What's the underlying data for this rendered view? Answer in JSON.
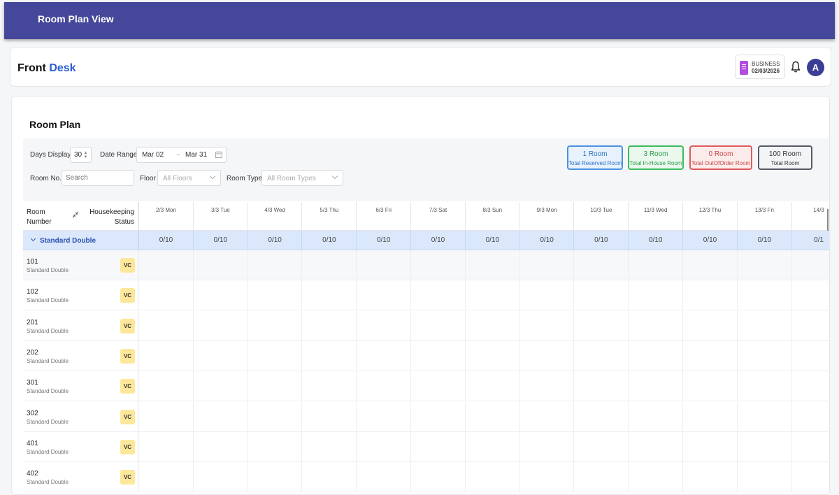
{
  "topbar": {
    "title": "Room Plan View"
  },
  "header": {
    "brand_part1": "Front",
    "brand_part2": "Desk",
    "business_label": "BUSINESS",
    "business_date": "02/03/2026",
    "avatar_initial": "A"
  },
  "room_plan": {
    "title": "Room Plan",
    "days_display_label": "Days Display",
    "days_display_value": "30",
    "date_range_label": "Date Range",
    "date_start": "Mar 02",
    "date_end": "Mar 31",
    "room_no_label": "Room No.",
    "room_no_placeholder": "Search",
    "floor_label": "Floor",
    "floor_value": "All Floors",
    "room_type_label": "Room Type",
    "room_type_value": "All Room Types"
  },
  "stats": [
    {
      "value": "1 Room",
      "caption": "Total Reserved Room",
      "color": "#4a90e2",
      "bg": "#e8f2fd",
      "text": "#2a6fc4"
    },
    {
      "value": "3 Room",
      "caption": "Total In-House Room",
      "color": "#3dbb5c",
      "bg": "#eaf8ee",
      "text": "#2b9b48"
    },
    {
      "value": "0 Room",
      "caption": "Total OutOfOrder Room",
      "color": "#e05a5a",
      "bg": "#fcebeb",
      "text": "#c94444"
    },
    {
      "value": "100 Room",
      "caption": "Total Room",
      "color": "#555a66",
      "bg": "#f3f4f6",
      "text": "#333"
    }
  ],
  "grid": {
    "col_room_line1": "Room",
    "col_room_line2": "Number",
    "col_hk_line1": "Housekeeping",
    "col_hk_line2": "Status",
    "days": [
      "2/3 Mon",
      "3/3 Tue",
      "4/3 Wed",
      "5/3 Thu",
      "6/3 Fri",
      "7/3 Sat",
      "8/3 Sun",
      "9/3 Mon",
      "10/3 Tue",
      "11/3 Wed",
      "12/3 Thu",
      "13/3 Fri",
      "14/3"
    ],
    "group_name": "Standard Double",
    "group_counts": [
      "0/10",
      "0/10",
      "0/10",
      "0/10",
      "0/10",
      "0/10",
      "0/10",
      "0/10",
      "0/10",
      "0/10",
      "0/10",
      "0/10",
      "0/1"
    ],
    "rooms": [
      {
        "number": "101",
        "type": "Standard Double",
        "status": "VC"
      },
      {
        "number": "102",
        "type": "Standard Double",
        "status": "VC"
      },
      {
        "number": "201",
        "type": "Standard Double",
        "status": "VC"
      },
      {
        "number": "202",
        "type": "Standard Double",
        "status": "VC"
      },
      {
        "number": "301",
        "type": "Standard Double",
        "status": "VC"
      },
      {
        "number": "302",
        "type": "Standard Double",
        "status": "VC"
      },
      {
        "number": "401",
        "type": "Standard Double",
        "status": "VC"
      },
      {
        "number": "402",
        "type": "Standard Double",
        "status": "VC"
      }
    ]
  }
}
